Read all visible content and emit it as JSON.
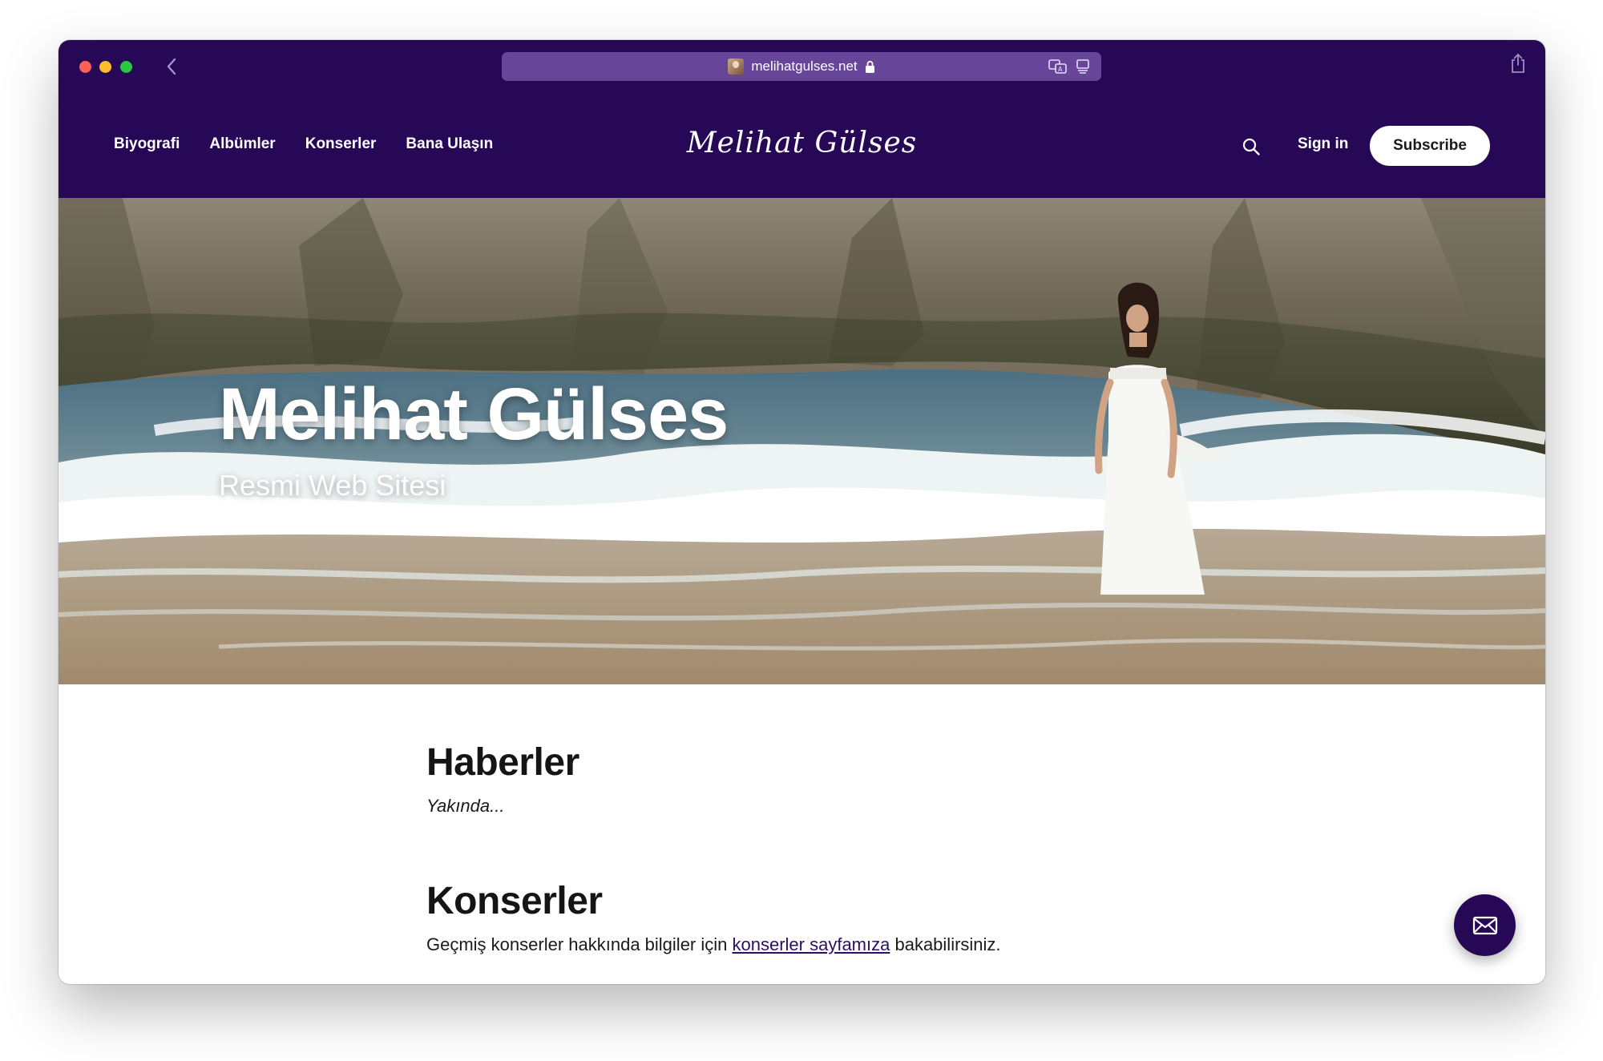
{
  "browser": {
    "url": "melihatgulses.net",
    "icons": {
      "back": "chevron-left-icon",
      "lock": "lock-icon",
      "translate": "translate-icon",
      "reader": "reader-icon",
      "share": "share-icon"
    },
    "colors": {
      "toolbar": "#260856",
      "urlbar": "#674699"
    }
  },
  "header": {
    "nav": [
      "Biyografi",
      "Albümler",
      "Konserler",
      "Bana Ulaşın"
    ],
    "logo": "Melihat Gülses",
    "sign_in": "Sign in",
    "subscribe": "Subscribe",
    "search_icon": "search-icon",
    "colors": {
      "background": "#260856",
      "subscribe_bg": "#ffffff"
    }
  },
  "hero": {
    "title": "Melihat Gülses",
    "subtitle": "Resmi Web Sitesi"
  },
  "news": {
    "heading": "Haberler",
    "text": "Yakında..."
  },
  "concerts": {
    "heading": "Konserler",
    "text_before": "Geçmiş konserler hakkında bilgiler için ",
    "link": "konserler sayfamıza",
    "text_after": " bakabilirsiniz."
  },
  "fab": {
    "icon": "mail-icon",
    "color": "#260856"
  }
}
